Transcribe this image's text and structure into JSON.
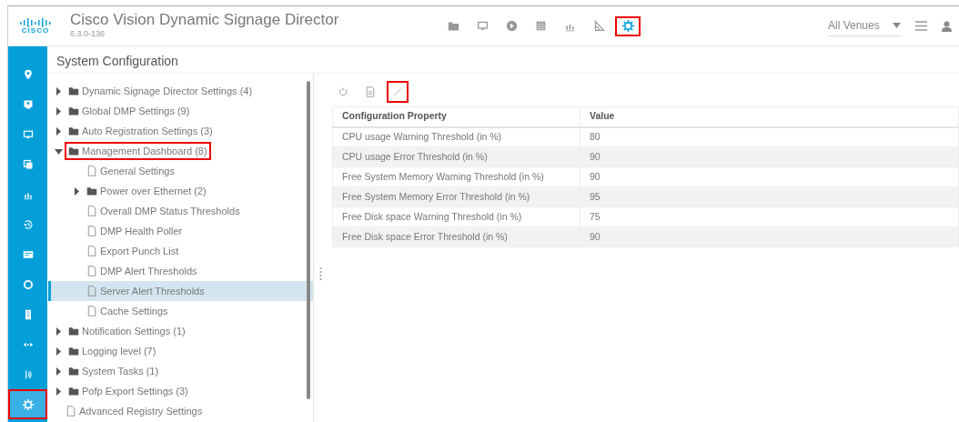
{
  "header": {
    "brand": "CISCO",
    "title": "Cisco Vision Dynamic Signage Director",
    "version": "6.3.0-136",
    "nav": [
      {
        "kind": "folder",
        "highlighted": false
      },
      {
        "kind": "monitor",
        "highlighted": false
      },
      {
        "kind": "play",
        "highlighted": false
      },
      {
        "kind": "calendar",
        "highlighted": false
      },
      {
        "kind": "chart",
        "highlighted": false
      },
      {
        "kind": "triangle",
        "highlighted": false
      },
      {
        "kind": "gear",
        "highlighted": true
      }
    ],
    "venue": "All Venues"
  },
  "sidebar": [
    {
      "kind": "pin",
      "selected": false,
      "highlighted": false
    },
    {
      "kind": "screen",
      "selected": false,
      "highlighted": false
    },
    {
      "kind": "monitor",
      "selected": false,
      "highlighted": false
    },
    {
      "kind": "copy",
      "selected": false,
      "highlighted": false
    },
    {
      "kind": "chart",
      "selected": false,
      "highlighted": false
    },
    {
      "kind": "history",
      "selected": false,
      "highlighted": false
    },
    {
      "kind": "card",
      "selected": false,
      "highlighted": false
    },
    {
      "kind": "ring",
      "selected": false,
      "highlighted": false
    },
    {
      "kind": "doc",
      "selected": false,
      "highlighted": false
    },
    {
      "kind": "arrows",
      "selected": false,
      "highlighted": false
    },
    {
      "kind": "signal",
      "selected": false,
      "highlighted": false
    },
    {
      "kind": "gear",
      "selected": true,
      "highlighted": true
    }
  ],
  "page_title": "System Configuration",
  "tree": [
    {
      "kind": "folder",
      "label": "Dynamic Signage Director Settings (4)",
      "expanded": false,
      "selected": false,
      "highlighted": false
    },
    {
      "kind": "folder",
      "label": "Global DMP Settings (9)",
      "expanded": false,
      "selected": false,
      "highlighted": false
    },
    {
      "kind": "folder",
      "label": "Auto Registration Settings (3)",
      "expanded": false,
      "selected": false,
      "highlighted": false
    },
    {
      "kind": "folder",
      "label": "Management Dashboard (8)",
      "expanded": true,
      "selected": false,
      "highlighted": true,
      "children": [
        {
          "kind": "file",
          "label": "General Settings",
          "selected": false,
          "highlighted": false
        },
        {
          "kind": "folder",
          "label": "Power over Ethernet (2)",
          "expanded": false,
          "selected": false,
          "highlighted": false
        },
        {
          "kind": "file",
          "label": "Overall DMP Status Thresholds",
          "selected": false,
          "highlighted": false
        },
        {
          "kind": "file",
          "label": "DMP Health Poller",
          "selected": false,
          "highlighted": false
        },
        {
          "kind": "file",
          "label": "Export Punch List",
          "selected": false,
          "highlighted": false
        },
        {
          "kind": "file",
          "label": "DMP Alert Thresholds",
          "selected": false,
          "highlighted": false
        },
        {
          "kind": "file",
          "label": "Server Alert Thresholds",
          "selected": true,
          "highlighted": false
        },
        {
          "kind": "file",
          "label": "Cache Settings",
          "selected": false,
          "highlighted": false
        }
      ]
    },
    {
      "kind": "folder",
      "label": "Notification Settings (1)",
      "expanded": false,
      "selected": false,
      "highlighted": false
    },
    {
      "kind": "folder",
      "label": "Logging level (7)",
      "expanded": false,
      "selected": false,
      "highlighted": false
    },
    {
      "kind": "folder",
      "label": "System Tasks (1)",
      "expanded": false,
      "selected": false,
      "highlighted": false
    },
    {
      "kind": "folder",
      "label": "Pofp Export Settings (3)",
      "expanded": false,
      "selected": false,
      "highlighted": false
    },
    {
      "kind": "file",
      "label": "Advanced Registry Settings",
      "selected": false,
      "highlighted": false
    }
  ],
  "toolbar": [
    {
      "kind": "refresh",
      "highlighted": false
    },
    {
      "kind": "document",
      "highlighted": false
    },
    {
      "kind": "edit",
      "highlighted": true
    }
  ],
  "table": {
    "columns": [
      "Configuration Property",
      "Value"
    ],
    "rows": [
      [
        "CPU usage Warning Threshold (in %)",
        "80"
      ],
      [
        "CPU usage Error Threshold (in %)",
        "90"
      ],
      [
        "Free System Memory Warning Threshold (in %)",
        "90"
      ],
      [
        "Free System Memory Error Threshold (in %)",
        "95"
      ],
      [
        "Free Disk space Warning Threshold (in %)",
        "75"
      ],
      [
        "Free Disk space Error Threshold (in %)",
        "90"
      ]
    ]
  }
}
